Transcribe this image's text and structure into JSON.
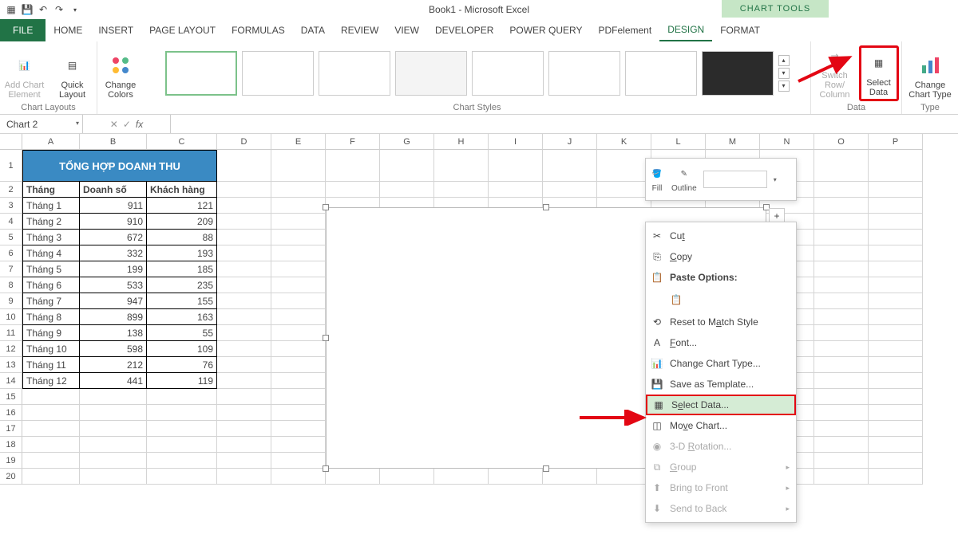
{
  "window_title": "Book1 - Microsoft Excel",
  "chart_tools_label": "CHART TOOLS",
  "tabs": {
    "file": "FILE",
    "list": [
      "HOME",
      "INSERT",
      "PAGE LAYOUT",
      "FORMULAS",
      "DATA",
      "REVIEW",
      "VIEW",
      "DEVELOPER",
      "POWER QUERY",
      "PDFelement",
      "DESIGN",
      "FORMAT"
    ],
    "active": "DESIGN"
  },
  "ribbon": {
    "chart_layouts": {
      "label": "Chart Layouts",
      "add_chart_element": "Add Chart Element",
      "quick_layout": "Quick Layout"
    },
    "change_colors": "Change Colors",
    "chart_styles_label": "Chart Styles",
    "data_group": {
      "label": "Data",
      "switch": "Switch Row/ Column",
      "select": "Select Data"
    },
    "type_group": {
      "label": "Type",
      "change": "Change Chart Type"
    }
  },
  "name_box": "Chart 2",
  "columns": [
    "A",
    "B",
    "C",
    "D",
    "E",
    "F",
    "G",
    "H",
    "I",
    "J",
    "K",
    "L",
    "M",
    "N",
    "O",
    "P"
  ],
  "col_widths": {
    "A": 72,
    "B": 84,
    "C": 88,
    "default": 68
  },
  "row_count": 20,
  "merged_title_rows": 1,
  "table": {
    "title": "TỔNG HỢP DOANH THU",
    "headers": [
      "Tháng",
      "Doanh số",
      "Khách hàng"
    ],
    "rows": [
      [
        "Tháng 1",
        "911",
        "121"
      ],
      [
        "Tháng 2",
        "910",
        "209"
      ],
      [
        "Tháng 3",
        "672",
        "88"
      ],
      [
        "Tháng 4",
        "332",
        "193"
      ],
      [
        "Tháng 5",
        "199",
        "185"
      ],
      [
        "Tháng 6",
        "533",
        "235"
      ],
      [
        "Tháng 7",
        "947",
        "155"
      ],
      [
        "Tháng 8",
        "899",
        "163"
      ],
      [
        "Tháng 9",
        "138",
        "55"
      ],
      [
        "Tháng 10",
        "598",
        "109"
      ],
      [
        "Tháng 11",
        "212",
        "76"
      ],
      [
        "Tháng 12",
        "441",
        "119"
      ]
    ]
  },
  "mini_toolbar": {
    "fill": "Fill",
    "outline": "Outline"
  },
  "context_menu": [
    {
      "label": "Cut",
      "mnemonic": "t",
      "icon": "cut",
      "disabled": false
    },
    {
      "label": "Copy",
      "mnemonic": "C",
      "icon": "copy",
      "disabled": false
    },
    {
      "label": "Paste Options:",
      "mnemonic": "",
      "icon": "paste",
      "bold": true
    },
    {
      "label": "",
      "icon": "paste-pic",
      "indent": true
    },
    {
      "label": "Reset to Match Style",
      "mnemonic": "a",
      "icon": "reset"
    },
    {
      "label": "Font...",
      "mnemonic": "F",
      "icon": "font"
    },
    {
      "label": "Change Chart Type...",
      "mnemonic": "",
      "icon": "chart"
    },
    {
      "label": "Save as Template...",
      "mnemonic": "",
      "icon": "save-tpl"
    },
    {
      "label": "Select Data...",
      "mnemonic": "e",
      "icon": "select-data",
      "hover": true,
      "boxed": true
    },
    {
      "label": "Move Chart...",
      "mnemonic": "v",
      "icon": "move"
    },
    {
      "label": "3-D Rotation...",
      "mnemonic": "R",
      "icon": "3d",
      "disabled": true
    },
    {
      "label": "Group",
      "mnemonic": "G",
      "icon": "group",
      "disabled": true,
      "arrow": true
    },
    {
      "label": "Bring to Front",
      "mnemonic": "",
      "icon": "front",
      "disabled": true,
      "arrow": true
    },
    {
      "label": "Send to Back",
      "mnemonic": "",
      "icon": "back",
      "disabled": true,
      "arrow": true
    }
  ]
}
